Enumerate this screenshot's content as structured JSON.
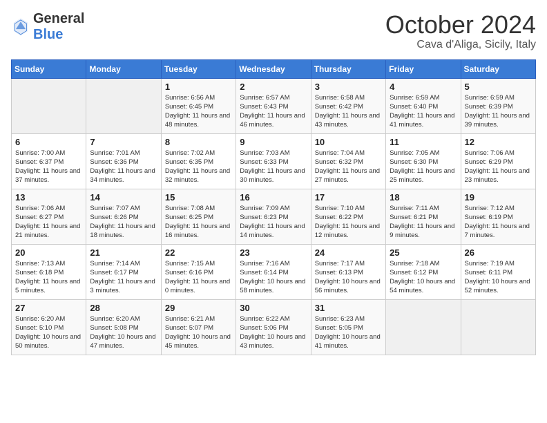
{
  "logo": {
    "general": "General",
    "blue": "Blue"
  },
  "title": "October 2024",
  "location": "Cava d'Aliga, Sicily, Italy",
  "headers": [
    "Sunday",
    "Monday",
    "Tuesday",
    "Wednesday",
    "Thursday",
    "Friday",
    "Saturday"
  ],
  "weeks": [
    [
      {
        "day": "",
        "empty": true
      },
      {
        "day": "",
        "empty": true
      },
      {
        "day": "1",
        "sunrise": "6:56 AM",
        "sunset": "6:45 PM",
        "daylight": "11 hours and 48 minutes."
      },
      {
        "day": "2",
        "sunrise": "6:57 AM",
        "sunset": "6:43 PM",
        "daylight": "11 hours and 46 minutes."
      },
      {
        "day": "3",
        "sunrise": "6:58 AM",
        "sunset": "6:42 PM",
        "daylight": "11 hours and 43 minutes."
      },
      {
        "day": "4",
        "sunrise": "6:59 AM",
        "sunset": "6:40 PM",
        "daylight": "11 hours and 41 minutes."
      },
      {
        "day": "5",
        "sunrise": "6:59 AM",
        "sunset": "6:39 PM",
        "daylight": "11 hours and 39 minutes."
      }
    ],
    [
      {
        "day": "6",
        "sunrise": "7:00 AM",
        "sunset": "6:37 PM",
        "daylight": "11 hours and 37 minutes."
      },
      {
        "day": "7",
        "sunrise": "7:01 AM",
        "sunset": "6:36 PM",
        "daylight": "11 hours and 34 minutes."
      },
      {
        "day": "8",
        "sunrise": "7:02 AM",
        "sunset": "6:35 PM",
        "daylight": "11 hours and 32 minutes."
      },
      {
        "day": "9",
        "sunrise": "7:03 AM",
        "sunset": "6:33 PM",
        "daylight": "11 hours and 30 minutes."
      },
      {
        "day": "10",
        "sunrise": "7:04 AM",
        "sunset": "6:32 PM",
        "daylight": "11 hours and 27 minutes."
      },
      {
        "day": "11",
        "sunrise": "7:05 AM",
        "sunset": "6:30 PM",
        "daylight": "11 hours and 25 minutes."
      },
      {
        "day": "12",
        "sunrise": "7:06 AM",
        "sunset": "6:29 PM",
        "daylight": "11 hours and 23 minutes."
      }
    ],
    [
      {
        "day": "13",
        "sunrise": "7:06 AM",
        "sunset": "6:27 PM",
        "daylight": "11 hours and 21 minutes."
      },
      {
        "day": "14",
        "sunrise": "7:07 AM",
        "sunset": "6:26 PM",
        "daylight": "11 hours and 18 minutes."
      },
      {
        "day": "15",
        "sunrise": "7:08 AM",
        "sunset": "6:25 PM",
        "daylight": "11 hours and 16 minutes."
      },
      {
        "day": "16",
        "sunrise": "7:09 AM",
        "sunset": "6:23 PM",
        "daylight": "11 hours and 14 minutes."
      },
      {
        "day": "17",
        "sunrise": "7:10 AM",
        "sunset": "6:22 PM",
        "daylight": "11 hours and 12 minutes."
      },
      {
        "day": "18",
        "sunrise": "7:11 AM",
        "sunset": "6:21 PM",
        "daylight": "11 hours and 9 minutes."
      },
      {
        "day": "19",
        "sunrise": "7:12 AM",
        "sunset": "6:19 PM",
        "daylight": "11 hours and 7 minutes."
      }
    ],
    [
      {
        "day": "20",
        "sunrise": "7:13 AM",
        "sunset": "6:18 PM",
        "daylight": "11 hours and 5 minutes."
      },
      {
        "day": "21",
        "sunrise": "7:14 AM",
        "sunset": "6:17 PM",
        "daylight": "11 hours and 3 minutes."
      },
      {
        "day": "22",
        "sunrise": "7:15 AM",
        "sunset": "6:16 PM",
        "daylight": "11 hours and 0 minutes."
      },
      {
        "day": "23",
        "sunrise": "7:16 AM",
        "sunset": "6:14 PM",
        "daylight": "10 hours and 58 minutes."
      },
      {
        "day": "24",
        "sunrise": "7:17 AM",
        "sunset": "6:13 PM",
        "daylight": "10 hours and 56 minutes."
      },
      {
        "day": "25",
        "sunrise": "7:18 AM",
        "sunset": "6:12 PM",
        "daylight": "10 hours and 54 minutes."
      },
      {
        "day": "26",
        "sunrise": "7:19 AM",
        "sunset": "6:11 PM",
        "daylight": "10 hours and 52 minutes."
      }
    ],
    [
      {
        "day": "27",
        "sunrise": "6:20 AM",
        "sunset": "5:10 PM",
        "daylight": "10 hours and 50 minutes."
      },
      {
        "day": "28",
        "sunrise": "6:20 AM",
        "sunset": "5:08 PM",
        "daylight": "10 hours and 47 minutes."
      },
      {
        "day": "29",
        "sunrise": "6:21 AM",
        "sunset": "5:07 PM",
        "daylight": "10 hours and 45 minutes."
      },
      {
        "day": "30",
        "sunrise": "6:22 AM",
        "sunset": "5:06 PM",
        "daylight": "10 hours and 43 minutes."
      },
      {
        "day": "31",
        "sunrise": "6:23 AM",
        "sunset": "5:05 PM",
        "daylight": "10 hours and 41 minutes."
      },
      {
        "day": "",
        "empty": true
      },
      {
        "day": "",
        "empty": true
      }
    ]
  ]
}
